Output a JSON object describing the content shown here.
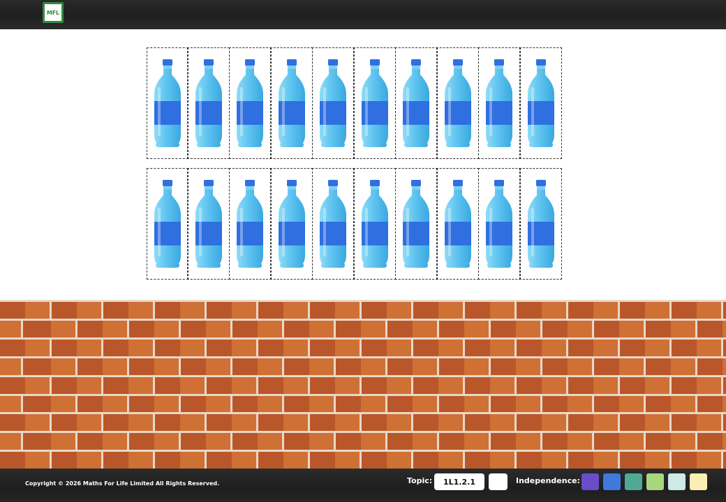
{
  "header": {
    "logo_text": "MFL",
    "logo_color": "#2f8c3f"
  },
  "bottle_grid": {
    "rows": 2,
    "columns": 10,
    "item_icon": "water-bottle-icon",
    "bottle_colors": {
      "body": "#5fc4f0",
      "label": "#2f6fe0",
      "cap": "#2f6fe0"
    }
  },
  "footer": {
    "copyright": "Copyright © 2026 Maths For Life Limited All Rights Reserved.",
    "topic_label": "Topic:",
    "topic_value": "1L1.2.1",
    "independence_label": "Independence:",
    "independence_colors": [
      "#6a4cc8",
      "#3f79dd",
      "#4fa995",
      "#a8d67d",
      "#cfe9e6",
      "#fbeeb2"
    ]
  }
}
